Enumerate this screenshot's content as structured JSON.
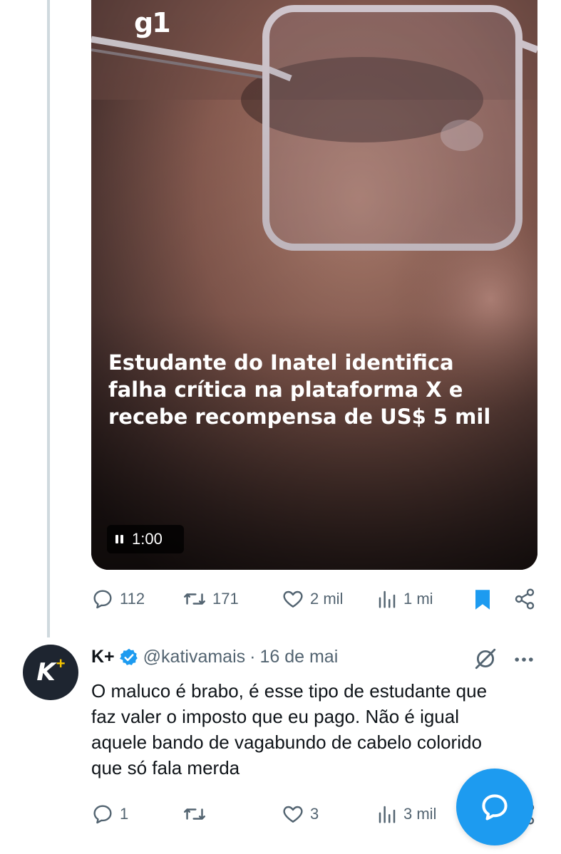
{
  "media": {
    "logo": "g1",
    "headline_lines": [
      "Estudante do Inatel identifica",
      "falha crítica na plataforma X e",
      "recebe recompensa de US$ 5 mil"
    ],
    "video_time": "1:00"
  },
  "post_actions": {
    "replies": "112",
    "reposts": "171",
    "likes": "2 mil",
    "views": "1 mi"
  },
  "reply": {
    "avatar_text": "K",
    "avatar_plus": "+",
    "name": "K+",
    "handle": "@kativamais",
    "separator": "·",
    "date": "16 de mai",
    "text_lines": [
      "O maluco é brabo, é esse tipo de estudante que",
      "faz valer o imposto que eu pago. Não é igual",
      "aquele bando de vagabundo de cabelo colorido",
      "que só fala merda"
    ],
    "actions": {
      "replies": "1",
      "reposts": "",
      "likes": "3",
      "views": "3 mil"
    }
  },
  "colors": {
    "accent": "#1d9bf0",
    "muted": "#536471",
    "verified": "#1d9bf0"
  }
}
